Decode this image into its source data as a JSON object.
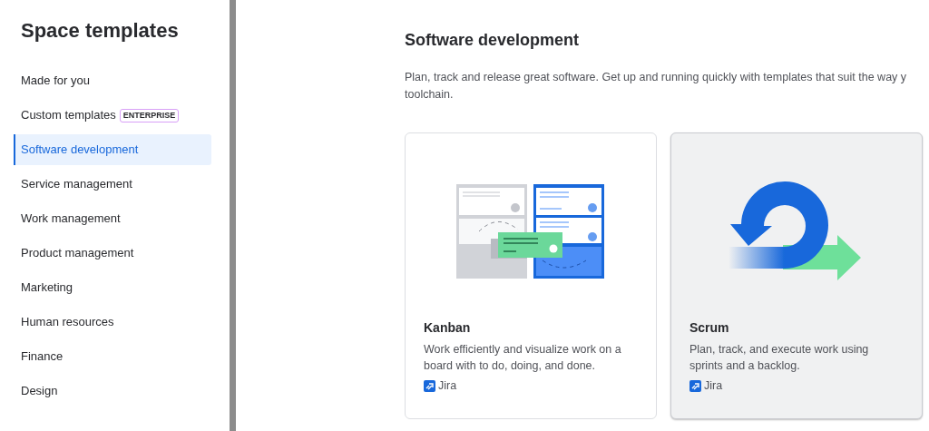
{
  "sidebar": {
    "title": "Space templates",
    "items": [
      {
        "label": "Made for you",
        "selected": false
      },
      {
        "label": "Custom templates",
        "badge": "ENTERPRISE",
        "selected": false
      },
      {
        "label": "Software development",
        "selected": true
      },
      {
        "label": "Service management",
        "selected": false
      },
      {
        "label": "Work management",
        "selected": false
      },
      {
        "label": "Product management",
        "selected": false
      },
      {
        "label": "Marketing",
        "selected": false
      },
      {
        "label": "Human resources",
        "selected": false
      },
      {
        "label": "Finance",
        "selected": false
      },
      {
        "label": "Design",
        "selected": false
      }
    ]
  },
  "main": {
    "heading": "Software development",
    "description": [
      "Plan, track and release great software. Get up and running quickly with templates that suit the way y",
      "toolchain."
    ],
    "cards": [
      {
        "kind": "kanban",
        "title": "Kanban",
        "description": "Work efficiently and visualize work on a board with to do, doing, and done.",
        "product": "Jira",
        "hovered": false
      },
      {
        "kind": "scrum",
        "title": "Scrum",
        "description": "Plan, track, and execute work using sprints and a backlog.",
        "product": "Jira",
        "hovered": true
      }
    ]
  }
}
